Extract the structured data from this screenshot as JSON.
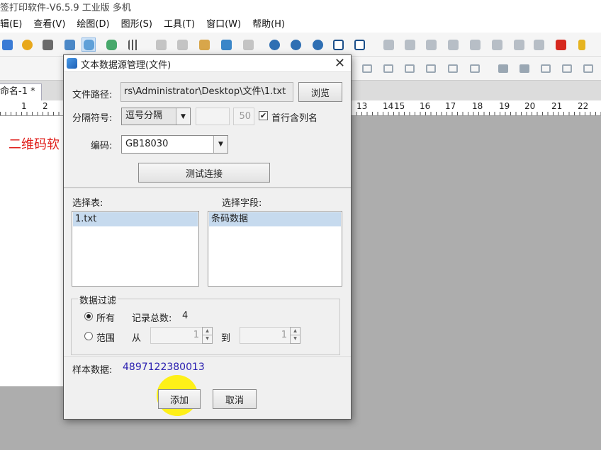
{
  "window": {
    "title": "签打印软件-V6.5.9 工业版 多机"
  },
  "menu": [
    "辑(E)",
    "查看(V)",
    "绘图(D)",
    "图形(S)",
    "工具(T)",
    "窗口(W)",
    "帮助(H)"
  ],
  "document": {
    "tab": "命名-1 *",
    "ruler_numbers": [
      "1",
      "2",
      "13",
      "14",
      "15",
      "16",
      "17",
      "18",
      "19",
      "20",
      "21",
      "22"
    ],
    "canvas_text": "二维码软"
  },
  "dialog": {
    "title": "文本数据源管理(文件)",
    "close_glyph": "✕",
    "file_path_label": "文件路径:",
    "file_path_value": "rs\\Administrator\\Desktop\\文件\\1.txt",
    "browse_label": "浏览",
    "separator_label": "分隔符号:",
    "separator_value": "逗号分隔",
    "separator_custom": "",
    "separator_number": "50",
    "first_row_label": "首行含列名",
    "first_row_checked": "✔",
    "encoding_label": "编码:",
    "encoding_value": "GB18030",
    "test_button": "测试连接",
    "select_table_label": "选择表:",
    "table_item": "1.txt",
    "select_field_label": "选择字段:",
    "field_item": "条码数据",
    "filter_title": "数据过滤",
    "filter_all": "所有",
    "record_count_label": "记录总数:",
    "record_count": "4",
    "filter_range": "范围",
    "from_label": "从",
    "from_value": "1",
    "to_label": "到",
    "to_value": "1",
    "sample_label": "样本数据:",
    "sample_value": "4897122380013",
    "add_button": "添加",
    "cancel_button": "取消"
  },
  "colors": {
    "canvas_text": "#e0201c",
    "sample_value": "#2a1fb0",
    "highlight": "#c6daee"
  }
}
